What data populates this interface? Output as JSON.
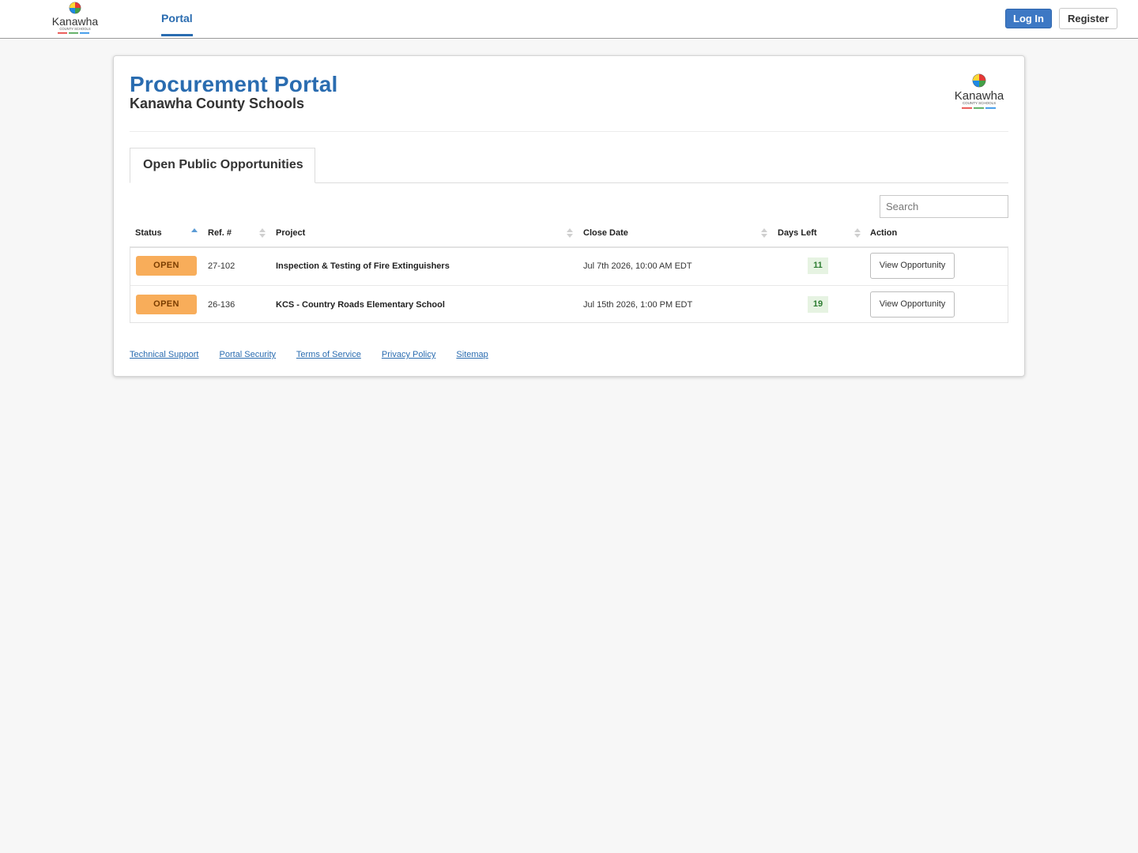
{
  "navbar": {
    "logo_text": "Kanawha",
    "logo_sub": "COUNTY SCHOOLS",
    "tab_label": "Portal",
    "login_label": "Log In",
    "register_label": "Register"
  },
  "header": {
    "title": "Procurement Portal",
    "org": "Kanawha County Schools",
    "logo_text": "Kanawha",
    "logo_sub": "COUNTY SCHOOLS"
  },
  "tabs": [
    {
      "label": "Open Public Opportunities",
      "active": true
    }
  ],
  "search": {
    "placeholder": "Search"
  },
  "table": {
    "columns": [
      "Status",
      "Ref. #",
      "Project",
      "Close Date",
      "Days Left",
      "Action"
    ],
    "rows": [
      {
        "status": "OPEN",
        "ref": "27-102",
        "project": "Inspection & Testing of Fire Extinguishers",
        "close_date": "Jul 7th 2026, 10:00 AM EDT",
        "days_left": "11",
        "action": "View Opportunity"
      },
      {
        "status": "OPEN",
        "ref": "26-136",
        "project": "KCS - Country Roads Elementary School",
        "close_date": "Jul 15th 2026, 1:00 PM EDT",
        "days_left": "19",
        "action": "View Opportunity"
      }
    ]
  },
  "footer": {
    "links": [
      "Technical Support",
      "Portal Security",
      "Terms of Service",
      "Privacy Policy",
      "Sitemap"
    ]
  },
  "colors": {
    "brand_blue": "#2a6cb0",
    "login_blue": "#3d78c4",
    "open_badge": "#f8ad5a",
    "days_bg": "#e6f3e2",
    "days_fg": "#2e7d32"
  },
  "icons": [
    "kanawha-logo",
    "sort-asc-icon",
    "sort-both-icon"
  ]
}
